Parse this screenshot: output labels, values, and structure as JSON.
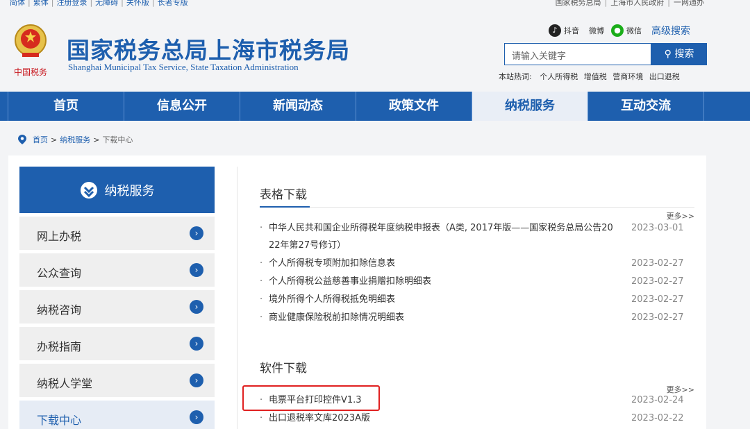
{
  "topbar": {
    "left_links": [
      "简体",
      "繁体",
      "注册登录",
      "无障碍",
      "关怀版",
      "长者专版"
    ],
    "right_links": [
      "国家税务总局",
      "上海市人民政府",
      "一网通办"
    ]
  },
  "header": {
    "title": "国家税务总局上海市税务局",
    "subtitle": "Shanghai Municipal Tax Service, State Taxation Administration",
    "logo_text": "中国税务",
    "social": [
      {
        "icon": "douyin-icon",
        "label": "抖音"
      },
      {
        "icon": "weibo-icon",
        "label": "微博"
      },
      {
        "icon": "wechat-icon",
        "label": "微信"
      }
    ],
    "advanced_search": "高级搜索",
    "search_placeholder": "请输入关键字",
    "search_button": "搜索",
    "hotwords_label": "本站热词:",
    "hotwords": [
      "个人所得税",
      "增值税",
      "营商环境",
      "出口退税"
    ]
  },
  "nav": {
    "items": [
      "首页",
      "信息公开",
      "新闻动态",
      "政策文件",
      "纳税服务",
      "互动交流"
    ],
    "active_index": 4
  },
  "breadcrumb": {
    "home": "首页",
    "level1": "纳税服务",
    "current": "下载中心"
  },
  "sidebar": {
    "header": "纳税服务",
    "items": [
      "网上办税",
      "公众查询",
      "纳税咨询",
      "办税指南",
      "纳税人学堂",
      "下载中心"
    ],
    "active_index": 5
  },
  "forms_section": {
    "title": "表格下载",
    "more": "更多>>",
    "items": [
      {
        "line1": "中华人民共和国企业所得税年度纳税申报表（A类, 2017年版——国家税务总局公告20",
        "line2": "22年第27号修订）",
        "date": "2023-03-01"
      },
      {
        "text": "个人所得税专项附加扣除信息表",
        "date": "2023-02-27"
      },
      {
        "text": "个人所得税公益慈善事业捐赠扣除明细表",
        "date": "2023-02-27"
      },
      {
        "text": "境外所得个人所得税抵免明细表",
        "date": "2023-02-27"
      },
      {
        "text": "商业健康保险税前扣除情况明细表",
        "date": "2023-02-27"
      }
    ]
  },
  "software_section": {
    "title": "软件下载",
    "more": "更多>>",
    "items": [
      {
        "text": "电票平台打印控件V1.3",
        "date": "2023-02-24"
      },
      {
        "text": "出口退税率文库2023A版",
        "date": "2023-02-22"
      }
    ]
  },
  "colors": {
    "brand_blue": "#1e5fae",
    "highlight_red": "#e02020"
  }
}
